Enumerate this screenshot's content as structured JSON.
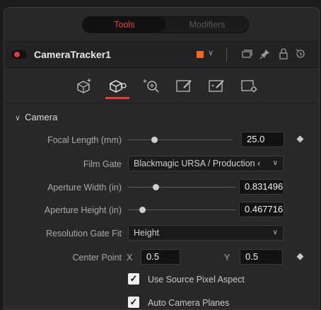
{
  "tabs": {
    "active": "Tools",
    "inactive": "Modifiers"
  },
  "header": {
    "tool_name": "CameraTracker1",
    "color_chip": "#ef6a1a"
  },
  "section": {
    "title": "Camera"
  },
  "focal_length": {
    "label": "Focal Length (mm)",
    "value": "25.0",
    "slider_fraction": 0.3
  },
  "film_gate": {
    "label": "Film Gate",
    "selected": "Blackmagic URSA / Production ‹"
  },
  "aperture_width": {
    "label": "Aperture Width (in)",
    "value": "0.831496",
    "slider_fraction": 0.26
  },
  "aperture_height": {
    "label": "Aperture Height (in)",
    "value": "0.467716",
    "slider_fraction": 0.14
  },
  "resolution_gate_fit": {
    "label": "Resolution Gate Fit",
    "selected": "Height"
  },
  "center_point": {
    "label": "Center Point",
    "x_label": "X",
    "x_value": "0.5",
    "y_label": "Y",
    "y_value": "0.5"
  },
  "checkboxes": {
    "use_source_pixel_aspect": {
      "label": "Use Source Pixel Aspect",
      "checked": true
    },
    "auto_camera_planes": {
      "label": "Auto Camera Planes",
      "checked": true
    }
  },
  "colors": {
    "accent": "#e0413a",
    "panel": "#28282b",
    "field": "#121214"
  }
}
